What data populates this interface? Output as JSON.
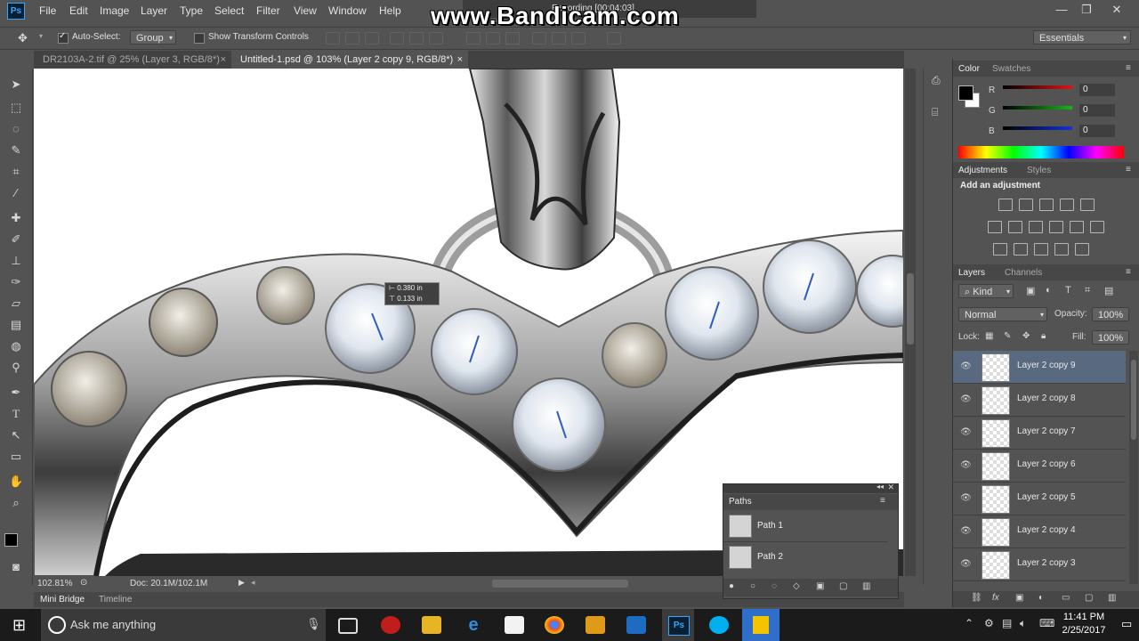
{
  "app": {
    "logo": "Ps",
    "menu": [
      "File",
      "Edit",
      "Image",
      "Layer",
      "Type",
      "Select",
      "Filter",
      "View",
      "Window",
      "Help"
    ],
    "window_controls": {
      "minimize": "—",
      "restore": "❐",
      "close": "✕"
    },
    "watermark": "www.Bandicam.com",
    "recording_text": "Recording [00:04:03]"
  },
  "options_bar": {
    "auto_select_label": "Auto-Select:",
    "auto_select_checked": true,
    "auto_select_mode": "Group",
    "show_transform_label": "Show Transform Controls",
    "workspace": "Essentials"
  },
  "tabs": [
    {
      "label": "DR2103A-2.tif @ 25% (Layer 3, RGB/8*)",
      "active": false
    },
    {
      "label": "Untitled-1.psd @ 103% (Layer 2 copy 9, RGB/8*)",
      "active": true
    }
  ],
  "tab_close": "×",
  "canvas_tooltip": {
    "width": "0.380 in",
    "height": "0.133 in"
  },
  "status": {
    "zoom": "102.81%",
    "doc": "Doc: 20.1M/102.1M"
  },
  "bottom_tabs": [
    "Mini Bridge",
    "Timeline"
  ],
  "color_panel": {
    "tabs": [
      "Color",
      "Swatches"
    ],
    "channels": [
      {
        "label": "R",
        "value": "0",
        "color": "#e01414"
      },
      {
        "label": "G",
        "value": "0",
        "color": "#14b814"
      },
      {
        "label": "B",
        "value": "0",
        "color": "#1433d6"
      }
    ]
  },
  "adjustments_panel": {
    "tabs": [
      "Adjustments",
      "Styles"
    ],
    "heading": "Add an adjustment"
  },
  "layers_panel": {
    "tabs": [
      "Layers",
      "Channels"
    ],
    "filter_kind": "Kind",
    "blend_mode": "Normal",
    "opacity_label": "Opacity:",
    "opacity_value": "100%",
    "lock_label": "Lock:",
    "fill_label": "Fill:",
    "fill_value": "100%",
    "layers": [
      {
        "name": "Layer 2 copy 9",
        "selected": true
      },
      {
        "name": "Layer 2 copy 8",
        "selected": false
      },
      {
        "name": "Layer 2 copy 7",
        "selected": false
      },
      {
        "name": "Layer 2 copy 6",
        "selected": false
      },
      {
        "name": "Layer 2 copy 5",
        "selected": false
      },
      {
        "name": "Layer 2 copy 4",
        "selected": false
      },
      {
        "name": "Layer 2 copy 3",
        "selected": false
      }
    ]
  },
  "paths_panel": {
    "title": "Paths",
    "paths": [
      "Path 1",
      "Path 2"
    ]
  },
  "taskbar": {
    "search_placeholder": "Ask me anything",
    "time": "11:41 PM",
    "date": "2/25/2017"
  }
}
